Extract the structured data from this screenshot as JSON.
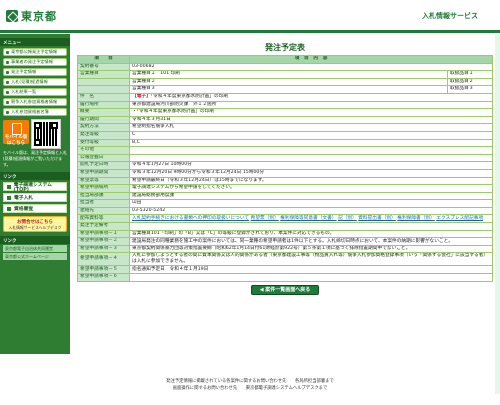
{
  "header": {
    "logo": "東京都",
    "service": "入札情報サービス"
  },
  "sidebar": {
    "section1": "メニュー",
    "menu": [
      "東京都公報発注予定情報",
      "事業者の発注予定情報",
      "発注予定情報",
      "入札(見積)経過情報",
      "入札結果一覧",
      "競争入札参加資格者情報",
      "入札参加資格者名簿"
    ],
    "mobile_label": "モバイル版はこちら",
    "mobile_note": "モバイル版は、発注予定情報と入札(見積)経過情報がご覧いただけます。",
    "section2": "リンク",
    "links": [
      "電子調達システム(TOP)",
      "電子入札",
      "資格審査"
    ],
    "cats_title": "お問合せはこちら",
    "cats_sub": "入札情報サービスヘルプデスク",
    "section3": "リンク",
    "foot_links": [
      "東京都電子自治体共同運営",
      "東京都公式ホームページ"
    ]
  },
  "main": {
    "title": "発注予定表",
    "col_item": "項　　目",
    "col_content": "項　目　内　容",
    "back": "案件一覧画面へ戻る"
  },
  "rows": [
    {
      "label": "契約番号",
      "value": "03-00682"
    },
    {
      "label": "営業種目",
      "value": "営業種目１　101 印刷",
      "extra": "取扱品目１"
    },
    {
      "label": "",
      "value": "営業種目２",
      "extra": "取扱品目２"
    },
    {
      "label": "",
      "value": "営業種目３",
      "extra": "取扱品目３"
    },
    {
      "label": "件　名",
      "tag": "【電子】",
      "value": "「令和４年度東京都水防計画」の印刷"
    },
    {
      "label": "履行場所",
      "value": "東京都建設局河川部防災課　外１２箇所"
    },
    {
      "label": "概要",
      "value": "・「令和４年度東京都水防計画」の印刷"
    },
    {
      "label": "履行期間",
      "value": "令和４年３月31日"
    },
    {
      "label": "契約方法",
      "value": "希望制指名競争入札"
    },
    {
      "label": "発注等級",
      "value": "C"
    },
    {
      "label": "受付等級",
      "value": "B,C"
    },
    {
      "label": "その他",
      "value": ""
    },
    {
      "label": "公報登載日",
      "value": ""
    },
    {
      "label": "開札予定日時",
      "value": "令和４年1月27日 10時00分"
    },
    {
      "label": "希望申請期間",
      "value": "令和３年12月20日 9時00分から令和３年12月24日 15時00分"
    },
    {
      "label": "希望票等",
      "value": "希望申請最終日（令和３年12月24日）は15時までになります。"
    },
    {
      "label": "希望申請場所",
      "value": "電子調達システムから希望申請をしてください。"
    },
    {
      "label": "担当局部課",
      "value": "建設局総務部用度課"
    },
    {
      "label": "担当者",
      "value": "山田"
    },
    {
      "label": "連絡先",
      "value": "03-5320-5242"
    },
    {
      "label": "配布資料等",
      "links": [
        "入札契約手続きにおける書類への押印の取扱いについて",
        "希望票（別）",
        "権利保障等同意書（文書）",
        "記（別）",
        "資料提出書（別）",
        "権利保障書（別）",
        "エクスプレス配記事項"
      ]
    },
    {
      "label": "発注予定備考",
      "value": ""
    },
    {
      "label": "希望申請事項－１",
      "value": "営業種目101「印刷」の「B」又は「C」の等級に登録がされており、本案件に対応できるもの。"
    },
    {
      "label": "希望申請事項－２",
      "value": "建設局発注の同種業務を施工中の案件においては、同一業種の希望申請者は1件以下とする。入札締切日時点において、本案件の納期に影響がないこと。",
      "wrap": true
    },
    {
      "label": "希望申請事項－３",
      "value": "東京都契約関係暴力団等対策措置要綱（昭和62年1月14日付61財経庶第922号）第５条第１項に基づく排除措置期間中でないこと。"
    },
    {
      "label": "希望申請事項－４",
      "value": "入札に参加しようとする者の間に資本関係又は人的関係がある者（東京都建設工事等（物品買入れ等）競争入札参加資格登録事項（いう「関係する会社」に該当する者）は入札に参加できません。",
      "wrap": true
    },
    {
      "label": "希望申請事項－５",
      "value": "指名通知予定日　令和４年１月19日"
    },
    {
      "label": "希望申請事項－６",
      "value": ""
    }
  ],
  "footer": {
    "line1": "発注予定情報に掲載されている各案件に関するお問い合わせ先　　各局所担当部署まで",
    "line2": "画面操作に関するお問い合わせ先　　東京都電子調達システムヘルプデスクまで"
  }
}
